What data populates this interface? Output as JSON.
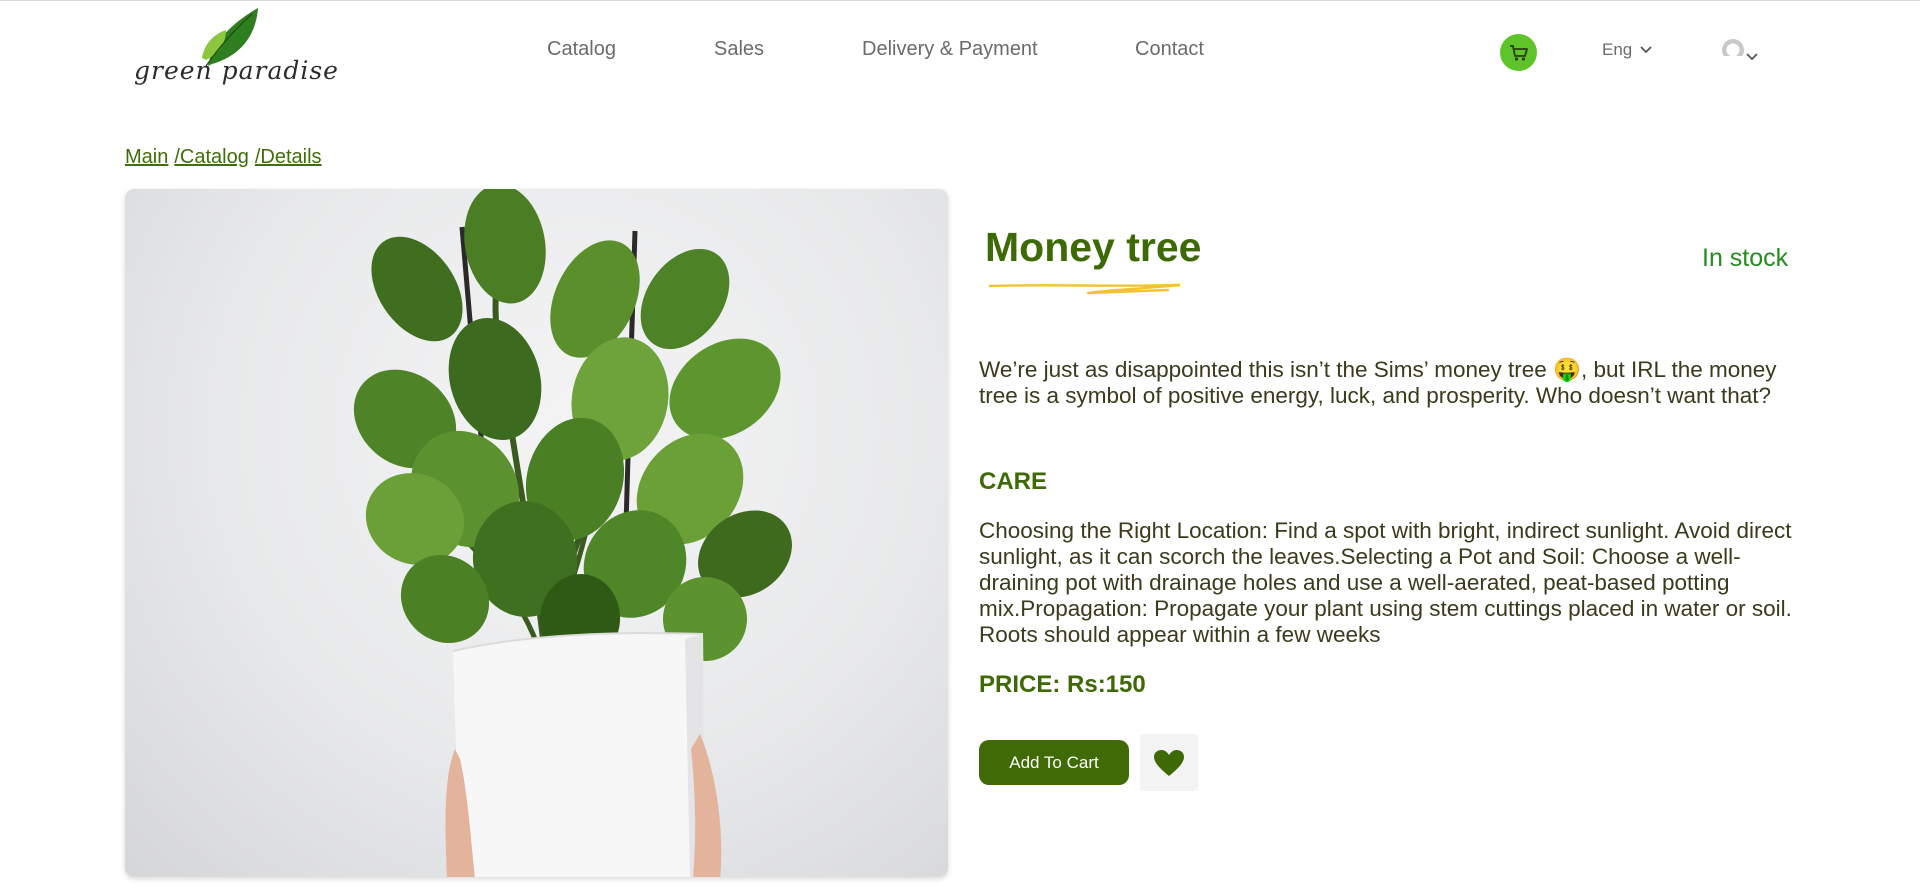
{
  "header": {
    "logo_text": "green paradise",
    "nav": [
      "Catalog",
      "Sales",
      "Delivery & Payment",
      "Contact"
    ],
    "language": "Eng"
  },
  "breadcrumb": [
    "Main",
    "/Catalog",
    "/Details"
  ],
  "product": {
    "title": "Money tree",
    "stock_status": "In stock",
    "description": "We’re just as disappointed this isn’t the Sims’ money tree 🤑, but IRL the money tree is a symbol of positive energy, luck, and prosperity. Who doesn’t want that?",
    "care_heading": "CARE",
    "care_text": "Choosing the Right Location: Find a spot with bright, indirect sunlight. Avoid direct sunlight, as it can scorch the leaves.Selecting a Pot and Soil: Choose a well-draining pot with drainage holes and use a well-aerated, peat-based potting mix.Propagation: Propagate your plant using stem cuttings placed in water or soil. Roots should appear within a few weeks",
    "price": "PRICE: Rs:150",
    "add_to_cart_label": "Add To Cart"
  },
  "colors": {
    "brand_green": "#3d6a05",
    "cart_green": "#5ec42a",
    "stock_green": "#238c1f",
    "accent_yellow": "#f2c230"
  },
  "icons": {
    "cart": "shopping-cart-icon",
    "lang_caret": "chevron-down-icon",
    "user": "user-avatar-icon",
    "favorite": "heart-icon"
  }
}
